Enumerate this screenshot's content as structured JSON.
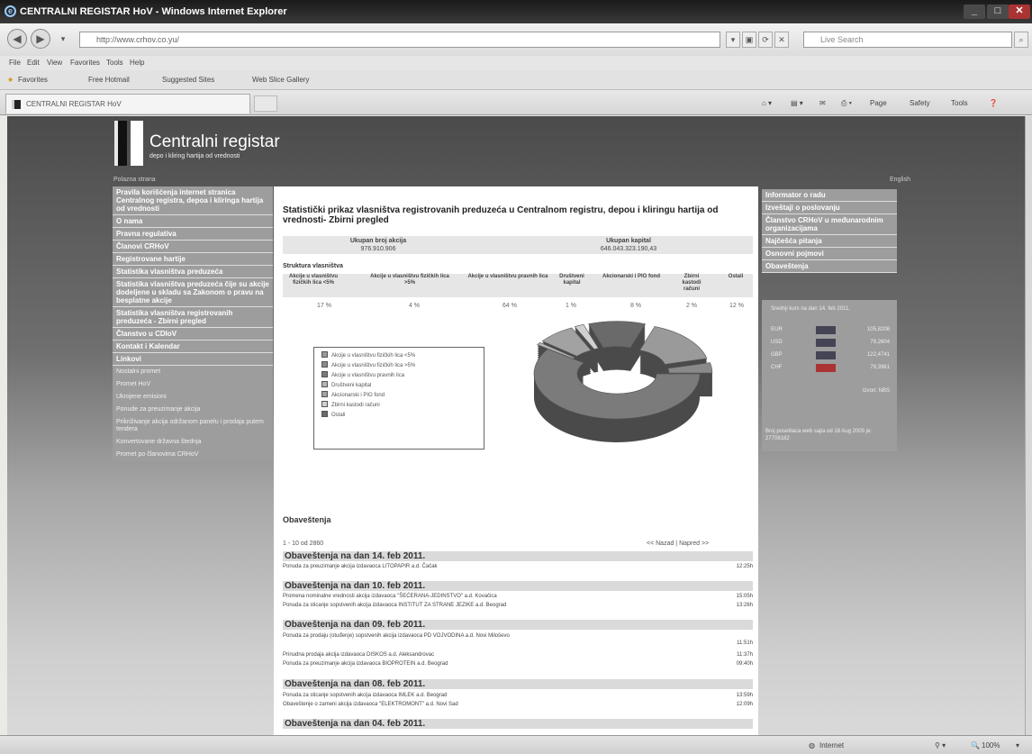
{
  "window": {
    "title": "CENTRALNI REGISTAR HoV - Windows Internet Explorer"
  },
  "browser": {
    "url": "http://www.crhov.co.yu/",
    "search_placeholder": "Live Search",
    "menu": [
      "File",
      "Edit",
      "View",
      "Favorites",
      "Tools",
      "Help"
    ],
    "favorites_label": "Favorites",
    "fav_links": [
      "Free Hotmail",
      "Suggested Sites",
      "Web Slice Gallery"
    ],
    "tab_title": "CENTRALNI REGISTAR HoV",
    "commands": [
      "Page",
      "Safety",
      "Tools"
    ]
  },
  "site": {
    "brand": "Centralni registar",
    "tagline": "depo i kliring hartija od vrednosti",
    "home_link": "Polazna strana",
    "lang_link": "English"
  },
  "left_nav": {
    "main_items": [
      "Pravila korišćenja internet stranica Centralnog registra, depoa i kliringa hartija od vrednosti",
      "O nama",
      "Pravna regulativa",
      "Članovi CRHoV",
      "Registrovane hartije",
      "Statistika vlasništva preduzeća",
      "Statistika vlasništva preduzeća čije su akcije dodeljene u skladu sa Zakonom o pravu na besplatne akcije",
      "Statistika vlasništva registrovanih preduzeća - Zbirni pregled",
      "Članstvo u CDIoV",
      "Kontakt i Kalendar",
      "Linkovi"
    ],
    "sub_items": [
      "Nostalni promet",
      "Promet HoV",
      "Ukrojene emisioni",
      "Ponude za preuzimanje akcija",
      "Prikriživanje akcija održanom panelu i prodaja putem tendera",
      "Konvertovane državna štednja",
      "Promet po članovima CRHoV"
    ]
  },
  "main": {
    "title": "Statistički prikaz vlasništva registrovanih preduzeća u Centralnom registru, depou i kliringu hartija od vrednosti- Zbirni pregled",
    "totals": {
      "shares_label": "Ukupan broj akcija",
      "shares_value": "976.910.906",
      "capital_label": "Ukupan kapital",
      "capital_value": "646.043.323.190,43"
    },
    "structure_label": "Struktura vlasništva",
    "structure_headers": [
      "Akcije u vlasništvu fizičkih lica <5%",
      "Akcije u vlasništvu fizičkih lica >5%",
      "Akcije u vlasništvu pravnih lica",
      "Društveni kapital",
      "Akcionarski i PIO fond",
      "Zbirni kastodi računi",
      "Ostali"
    ],
    "structure_values": [
      "17 %",
      "4 %",
      "64 %",
      "1 %",
      "8 %",
      "2 %",
      "12 %"
    ],
    "legend": [
      "Akcije u vlasništvu fizičkih lica <5%",
      "Akcije u vlasništvu fizičkih lica >5%",
      "Akcije u vlasništvu pravnih lica",
      "Društveni kapital",
      "Akcionarski i PIO fond",
      "Zbirni kastodi računi",
      "Ostali"
    ],
    "announcements_heading": "Obaveštenja",
    "range": "1 - 10 od 2860",
    "pager": "<< Nazad | Napred >>",
    "day_groups": [
      {
        "date": "Obaveštenja na dan 14. feb 2011.",
        "items": [
          {
            "text": "Ponuda za preuzimanje akcija izdavaoca LITOPAPIR a.d. Čačak",
            "time": "12:25h"
          }
        ]
      },
      {
        "date": "Obaveštenja na dan 10. feb 2011.",
        "items": [
          {
            "text": "Promena nominalne vrednosti akcija izdavaoca \"ŠEĆERANA-JEDINSTVO\" a.d. Kovačica",
            "time": "15:05h"
          },
          {
            "text": "Ponuda za sticanje sopstvenih akcija izdavaoca INSTITUT ZA STRANE JEZIKE a.d. Beograd",
            "time": "13:26h"
          }
        ]
      },
      {
        "date": "Obaveštenja na dan 09. feb 2011.",
        "items": [
          {
            "text": "Ponuda za prodaju (otuđenje) sopstvenih akcija izdavaoca PD VOJVODINA a.d. Novi Miloševo",
            "time": "11:51h"
          },
          {
            "text": "Prinudna prodaja akcija izdavaoca DISKOS a.d. Aleksandrovac",
            "time": "11:37h"
          },
          {
            "text": "Ponuda za preuzimanje akcija izdavaoca BIOPROTEIN a.d. Beograd",
            "time": "09:40h"
          }
        ]
      },
      {
        "date": "Obaveštenja na dan 08. feb 2011.",
        "items": [
          {
            "text": "Ponuda za sticanje sopstvenih akcija izdavaoca IMLEK a.d. Beograd",
            "time": "13:59h"
          },
          {
            "text": "Obaveštenje o zameni akcija izdavaoca \"ELEKTROMONT\" a.d. Novi Sad",
            "time": "12:09h"
          }
        ]
      },
      {
        "date": "Obaveštenja na dan 04. feb 2011.",
        "items": []
      }
    ]
  },
  "right_nav": {
    "items": [
      "Informator o radu",
      "Izveštaji o poslovanju",
      "Članstvo CRHoV u međunarodnim organizacijama",
      "Najčešća pitanja",
      "Osnovni pojmovi",
      "Obaveštenja"
    ],
    "rates_title": "Srednji kurs na dan 14. feb 2011.",
    "rates": [
      {
        "code": "EUR",
        "value": "105,8208"
      },
      {
        "code": "USD",
        "value": "79,2604"
      },
      {
        "code": "GBP",
        "value": "122,4741"
      },
      {
        "code": "CHF",
        "value": "79,3961"
      }
    ],
    "rates_more": "Izvori: NBS",
    "counter": "Broj posetilaca web sajta od 18 Aug 2005 je: 27708182"
  },
  "status": {
    "zone": "Internet",
    "zoom": "100%"
  },
  "chart_data": {
    "type": "pie",
    "title": "",
    "categories": [
      "Akcije u vlasništvu fizičkih lica <5%",
      "Akcije u vlasništvu fizičkih lica >5%",
      "Akcije u vlasništvu pravnih lica",
      "Društveni kapital",
      "Akcionarski i PIO fond",
      "Zbirni kastodi računi",
      "Ostali"
    ],
    "values": [
      17,
      4,
      64,
      1,
      8,
      2,
      12
    ],
    "legend": "left"
  }
}
